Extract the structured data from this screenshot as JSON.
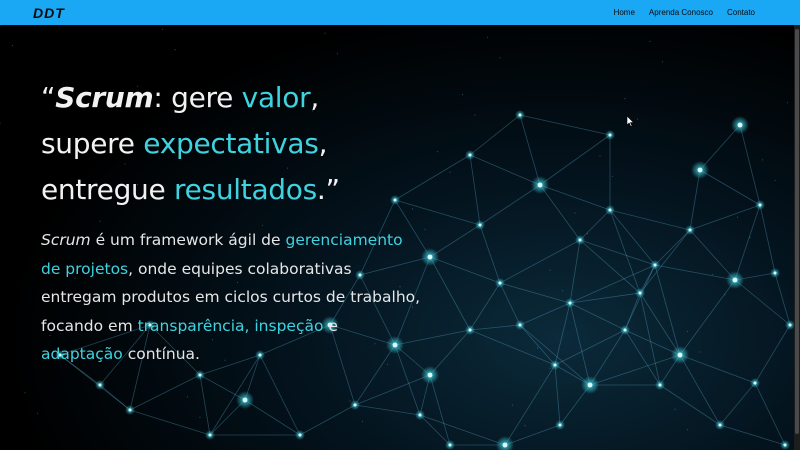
{
  "header": {
    "logo": "DDT",
    "nav": [
      "Home",
      "Aprenda Conosco",
      "Contato"
    ],
    "background_color": "#1aa7f4"
  },
  "hero": {
    "headline": {
      "open_quote": "“",
      "scrum": "Scrum",
      "part1": ": gere ",
      "valor": "valor",
      "comma1": ",",
      "supere": "supere ",
      "expectativas": "expectativas",
      "comma2": ",",
      "entregue": "entregue ",
      "resultados": "resultados",
      "close": ".”"
    },
    "description": {
      "scrum": "Scrum",
      "t1": " é um framework ágil de ",
      "gerenciamento": "gerenciamento de projetos",
      "t2": ", onde equipes colaborativas entregam produtos em ciclos curtos de trabalho, focando em ",
      "transparencia": "transparência",
      "c1": ", ",
      "inspecao": "inspeção",
      "c2": " e ",
      "adaptacao": "adaptação",
      "t3": " contínua."
    },
    "accent_color": "#3fd3e0"
  },
  "background": {
    "icon": "network-nodes-graphic"
  }
}
